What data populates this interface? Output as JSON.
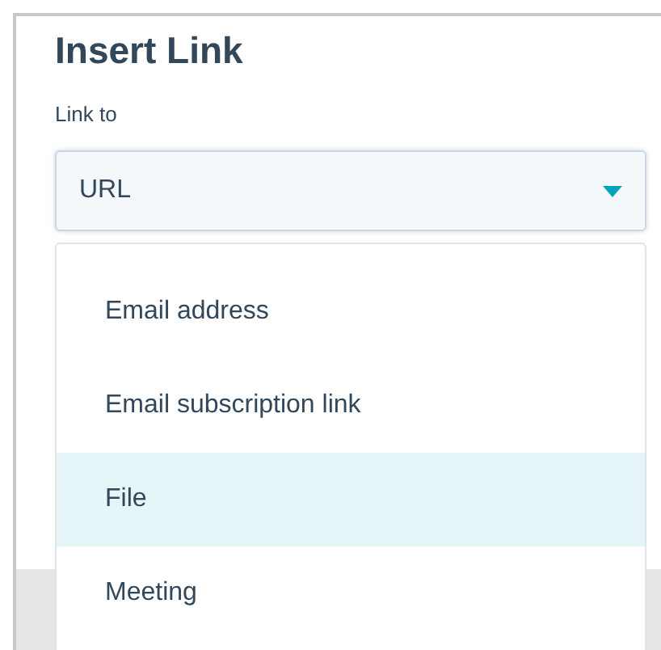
{
  "dialog": {
    "title": "Insert Link"
  },
  "link_to": {
    "label": "Link to",
    "value": "URL",
    "expanded": true
  },
  "options": [
    {
      "label": "Email address",
      "highlighted": false
    },
    {
      "label": "Email subscription link",
      "highlighted": false
    },
    {
      "label": "File",
      "highlighted": true
    },
    {
      "label": "Meeting",
      "highlighted": false
    }
  ]
}
